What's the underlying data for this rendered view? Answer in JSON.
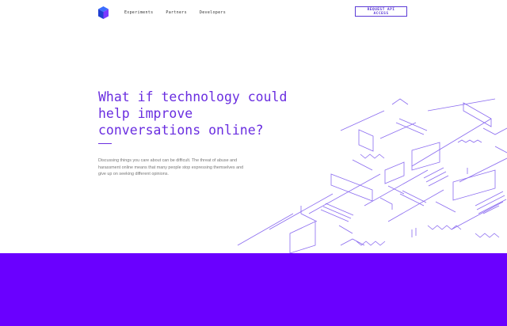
{
  "header": {
    "nav": [
      {
        "label": "Experiments"
      },
      {
        "label": "Partners"
      },
      {
        "label": "Developers"
      }
    ],
    "cta_label": "REQUEST API ACCESS"
  },
  "hero": {
    "title_lines": [
      "What if technology could",
      "help improve",
      "conversations online?"
    ],
    "body": "Discussing things you care about can be difficult. The threat of abuse and harassment online means that many people stop expressing themselves and give up on seeking different opinions."
  },
  "colors": {
    "accent": "#6a2ee0",
    "band": "#6a00ff",
    "illustration_stroke": "#8b6cf0"
  },
  "icons": {
    "logo": "perspective-cube-logo"
  }
}
